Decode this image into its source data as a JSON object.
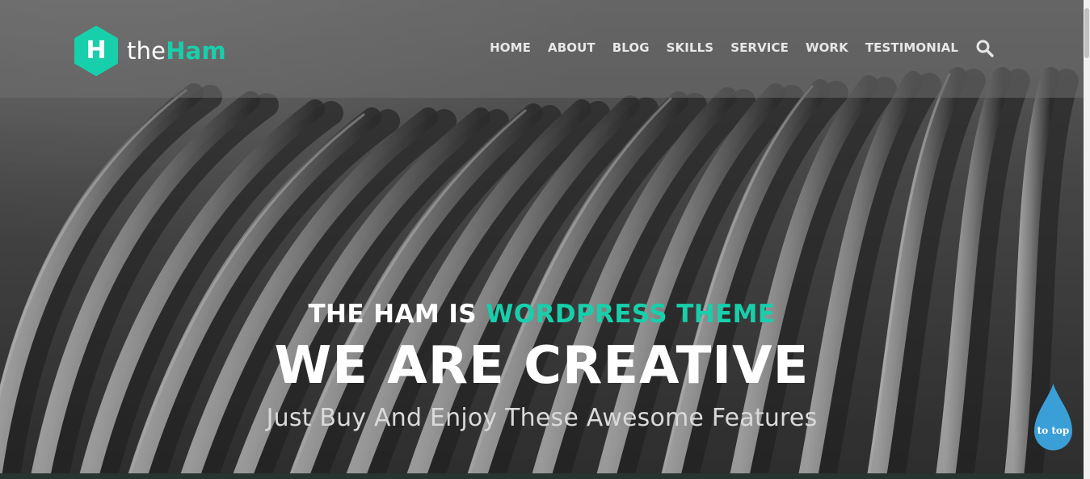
{
  "brand": {
    "logo_letter": "H",
    "name_prefix": "the",
    "name_accent": "Ham",
    "accent_color": "#18cfab"
  },
  "nav": {
    "items": [
      "HOME",
      "ABOUT",
      "BLOG",
      "SKILLS",
      "SERVICE",
      "WORK",
      "TESTIMONIAL"
    ],
    "search_icon": "search-icon"
  },
  "hero": {
    "headline_plain": "THE HAM IS ",
    "headline_accent": "WORDPRESS THEME",
    "title": "WE ARE CREATIVE",
    "subtitle": "Just Buy And Enjoy These Awesome Features"
  },
  "to_top": {
    "label": "to top",
    "color": "#3a9fd6"
  }
}
